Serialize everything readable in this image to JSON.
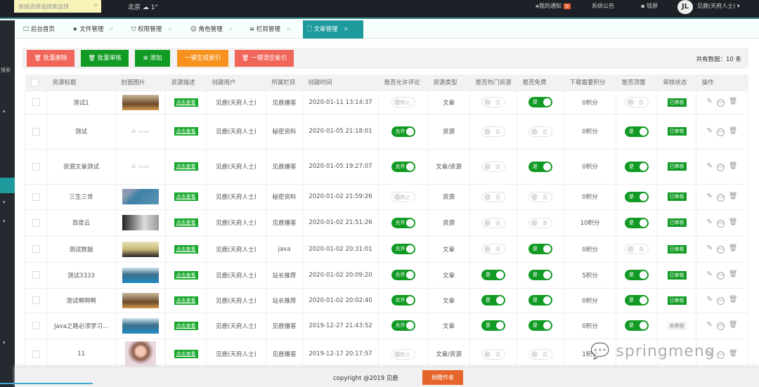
{
  "topbar": {
    "search_placeholder": "直接选择或搜索选择",
    "city": "北京",
    "temp": "1°",
    "notice": "我的通知",
    "notice_count": "0",
    "announce": "系统公告",
    "lock": "锁屏",
    "avatar": "JL",
    "user": "见鹿(天府人士)"
  },
  "sidebar": {
    "label": "搜索"
  },
  "tabs": [
    {
      "label": "后台首页",
      "icon": "monitor-icon"
    },
    {
      "label": "文件管理",
      "icon": "star-icon"
    },
    {
      "label": "权限管理",
      "icon": "shield-icon"
    },
    {
      "label": "角色管理",
      "icon": "smile-icon"
    },
    {
      "label": "栏目管理",
      "icon": "list-icon"
    },
    {
      "label": "文章管理",
      "icon": "file-icon",
      "active": true
    }
  ],
  "toolbar": {
    "buttons": [
      {
        "label": "批量删除",
        "color": "#f0665a",
        "icon": "trash-icon"
      },
      {
        "label": "批量审核",
        "color": "#129b24",
        "icon": "trash-icon"
      },
      {
        "label": "添加",
        "color": "#129b24",
        "icon": "plus-circle-icon"
      },
      {
        "label": "一键生成索引",
        "color": "#f7921e",
        "icon": ""
      },
      {
        "label": "一键清空索引",
        "color": "#f0665a",
        "icon": "trash-icon"
      }
    ],
    "total": "共有数据：10 条"
  },
  "table": {
    "headers": [
      "资源标题",
      "封面图片",
      "资源描述",
      "创建用户",
      "所属栏目",
      "创建时间",
      "是否允许评论",
      "资源类型",
      "是否热门资源",
      "是否免费",
      "下载需要积分",
      "是否顶置",
      "审核状态",
      "操作"
    ],
    "view_label": "点击查看",
    "on_comment": "允许",
    "off_comment": "禁止",
    "yes": "是",
    "no": "否",
    "rows": [
      {
        "title": "测试1",
        "cover": "sunset",
        "user": "见鹿(天府人士)",
        "column": "见鹿播客",
        "time": "2020-01-11 13:14:37",
        "comment": false,
        "type": "文章",
        "hot": false,
        "free": true,
        "points": "0积分",
        "top": false,
        "status": "已审核"
      },
      {
        "title": "测试",
        "cover": "placeholder",
        "user": "见鹿(天府人士)",
        "column": "秘密资料",
        "time": "2020-01-05 21:18:01",
        "comment": true,
        "type": "资源",
        "hot": false,
        "free": false,
        "points": "0积分",
        "top": true,
        "status": "已审核"
      },
      {
        "title": "资源文章测试",
        "cover": "placeholder",
        "user": "见鹿(天府人士)",
        "column": "见鹿播客",
        "time": "2020-01-05 19:27:07",
        "comment": true,
        "type": "文章/资源",
        "hot": false,
        "free": true,
        "points": "0积分",
        "top": true,
        "status": "已审核"
      },
      {
        "title": "三生三世",
        "cover": "blue",
        "user": "见鹿(天府人士)",
        "column": "秘密资料",
        "time": "2020-01-02 21:59:26",
        "comment": false,
        "type": "资源",
        "hot": false,
        "free": false,
        "points": "0积分",
        "top": true,
        "status": "已审核"
      },
      {
        "title": "百度云",
        "cover": "dark",
        "user": "见鹿(天府人士)",
        "column": "见鹿播客",
        "time": "2020-01-02 21:51:26",
        "comment": true,
        "type": "资源",
        "hot": false,
        "free": false,
        "points": "10积分",
        "top": true,
        "status": "已审核"
      },
      {
        "title": "测试数据",
        "cover": "tree",
        "user": "见鹿(天府人士)",
        "column": "java",
        "time": "2020-01-02 20:31:01",
        "comment": true,
        "type": "文章",
        "hot": false,
        "free": true,
        "points": "0积分",
        "top": false,
        "status": "已审核"
      },
      {
        "title": "测试3333",
        "cover": "lake",
        "user": "见鹿(天府人士)",
        "column": "站长推荐",
        "time": "2020-01-02 20:09:20",
        "comment": true,
        "type": "文章",
        "hot": true,
        "free": true,
        "points": "5积分",
        "top": true,
        "status": "已审核"
      },
      {
        "title": "测试啊啊啊",
        "cover": "sunset",
        "user": "见鹿(天府人士)",
        "column": "站长推荐",
        "time": "2020-01-02 20:02:40",
        "comment": true,
        "type": "文章",
        "hot": true,
        "free": true,
        "points": "0积分",
        "top": true,
        "status": "已审核"
      },
      {
        "title": "Java之路必须学习...",
        "cover": "lake",
        "user": "见鹿(天府人士)",
        "column": "见鹿播客",
        "time": "2019-12-27 21:43:52",
        "comment": true,
        "type": "文章",
        "hot": true,
        "free": true,
        "points": "0积分",
        "top": true,
        "status": "未审核"
      },
      {
        "title": "11",
        "cover": "portrait",
        "user": "见鹿(天府人士)",
        "column": "见鹿播客",
        "time": "2019-12-17 20:17:57",
        "comment": false,
        "type": "文章/资源",
        "hot": false,
        "free": false,
        "points": "1积分",
        "top": null,
        "status": null
      }
    ]
  },
  "footer": {
    "copyright": "copyright @2019 见鹿",
    "donate": "捐赠作者"
  },
  "watermark": "springmeng"
}
